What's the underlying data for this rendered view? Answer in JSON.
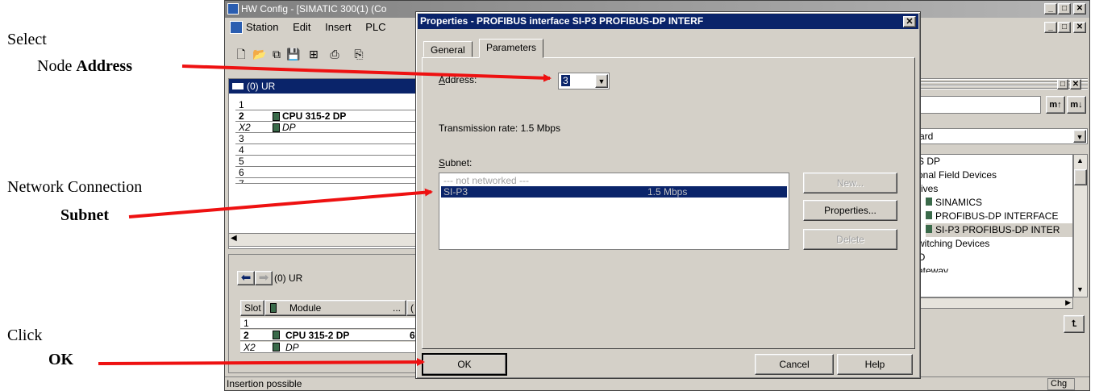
{
  "annotations": {
    "address": {
      "line1": "Select",
      "line2_plain": "Node ",
      "line2_bold": "Address"
    },
    "subnet": {
      "line1": "Network Connection",
      "line2_bold": "Subnet"
    },
    "ok": {
      "line1": "Click",
      "line2_bold": "OK"
    }
  },
  "hw_window": {
    "title": "HW Config - [SIMATIC 300(1) (Co",
    "menu": [
      "Station",
      "Edit",
      "Insert",
      "PLC"
    ],
    "status": "Insertion possible",
    "status_right": "Chg"
  },
  "rack": {
    "title": "(0) UR",
    "rows": [
      {
        "slot": "1",
        "module": ""
      },
      {
        "slot": "2",
        "module": "CPU 315-2 DP"
      },
      {
        "slot": "X2",
        "module": "DP"
      },
      {
        "slot": "3",
        "module": ""
      },
      {
        "slot": "4",
        "module": ""
      },
      {
        "slot": "5",
        "module": ""
      },
      {
        "slot": "6",
        "module": ""
      },
      {
        "slot": "7",
        "module": ""
      }
    ]
  },
  "detail": {
    "label": "(0)  UR",
    "col_slot": "Slot",
    "col_module": "Module",
    "col_more": "...",
    "col_next": "(",
    "rows": [
      {
        "slot": "1",
        "module": "",
        "extra": ""
      },
      {
        "slot": "2",
        "module": "CPU 315-2 DP",
        "extra": "6"
      },
      {
        "slot": "X2",
        "module": "DP",
        "extra": ""
      }
    ]
  },
  "catalog": {
    "profile": "ard",
    "tree": [
      "S DP",
      "onal Field Devices",
      "rives",
      "SINAMICS",
      "PROFIBUS-DP INTERFACE",
      "SI-P3 PROFIBUS-DP INTER",
      "witching Devices",
      "O",
      "ateway"
    ]
  },
  "dialog": {
    "title": "Properties - PROFIBUS interface  SI-P3 PROFIBUS-DP INTERF",
    "tabs": [
      "General",
      "Parameters"
    ],
    "address_label": "Address:",
    "address_value": "3",
    "transmission_rate": "Transmission rate: 1.5 Mbps",
    "subnet_label": "Subnet:",
    "subnets": [
      {
        "name": "--- not networked ---",
        "rate": "",
        "selected": false
      },
      {
        "name": "SI-P3",
        "rate": "1.5 Mbps",
        "selected": true
      }
    ],
    "buttons": {
      "new": "New...",
      "properties": "Properties...",
      "delete": "Delete",
      "ok": "OK",
      "cancel": "Cancel",
      "help": "Help"
    }
  },
  "colors": {
    "arrow": "#ee1111",
    "selection": "#0a246a",
    "dialog_bg": "#d4d0c8"
  }
}
